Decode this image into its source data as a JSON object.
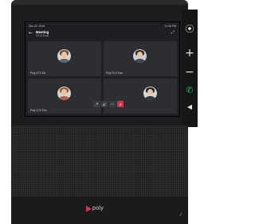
{
  "status": {
    "date": "Dec 02, 2019",
    "time": "12:30 PM"
  },
  "meeting": {
    "title": "Meeting",
    "subtitle": "00:15  Ends",
    "back_icon": "back-arrow-icon",
    "layout_icon": "gallery-layout-icon"
  },
  "participants": [
    {
      "name": "Poly CCX Six"
    },
    {
      "name": "Poly CCX Four"
    },
    {
      "name": "Poly CCX Five"
    },
    {
      "name": ""
    }
  ],
  "controls": [
    {
      "icon": "microphone-icon",
      "glyph": "🎤"
    },
    {
      "icon": "speaker-icon",
      "glyph": "🔊"
    },
    {
      "icon": "more-icon",
      "glyph": "•••"
    },
    {
      "icon": "end-call-icon",
      "glyph": "✕"
    }
  ],
  "hardware_buttons": [
    {
      "icon": "camera-icon",
      "glyph": "⦿"
    },
    {
      "icon": "volume-up-icon",
      "glyph": "+"
    },
    {
      "icon": "volume-down-icon",
      "glyph": "−"
    },
    {
      "icon": "call-icon",
      "glyph": "✆"
    },
    {
      "icon": "speaker-hw-icon",
      "glyph": "◀"
    }
  ],
  "brand": {
    "logo_text": "poly",
    "accent": "#d1344d"
  }
}
